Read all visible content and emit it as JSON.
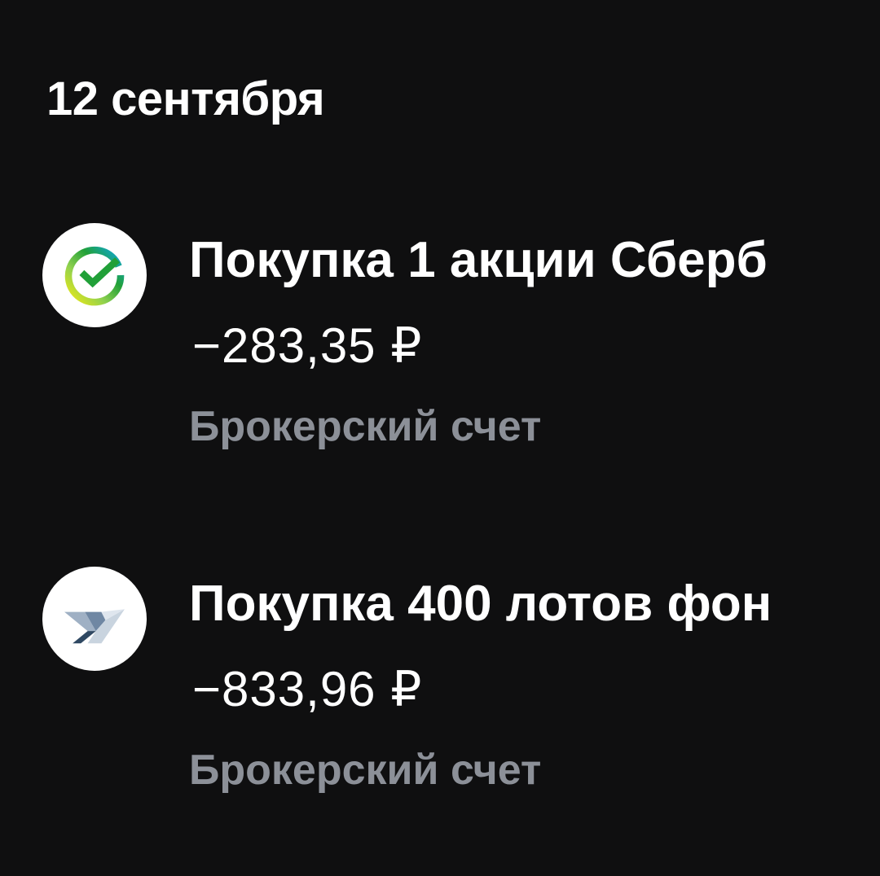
{
  "date_header": "12 сентября",
  "operations": [
    {
      "icon": "sber-logo-icon",
      "title": "Покупка 1 акции Сберб",
      "amount": "−283,35 ₽",
      "account": "Брокерский счет"
    },
    {
      "icon": "fund-logo-icon",
      "title": "Покупка 400 лотов фон",
      "amount": "−833,96 ₽",
      "account": "Брокерский счет"
    }
  ],
  "colors": {
    "background": "#0f0f10",
    "text_primary": "#ffffff",
    "text_secondary": "#8c9098",
    "icon_background": "#ffffff",
    "sber_green": "#21a038"
  }
}
